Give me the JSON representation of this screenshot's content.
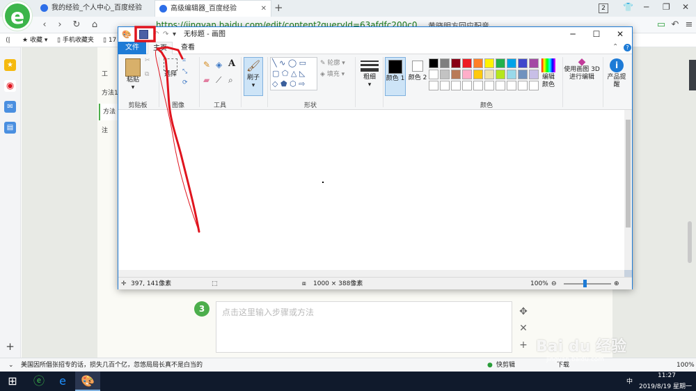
{
  "browser": {
    "tabs": [
      {
        "title": "我的经验_个人中心_百度经验"
      },
      {
        "title": "高级编辑器_百度经验"
      }
    ],
    "new_tab": "+",
    "tab_count": "2",
    "url": "https://jingyan.baidu.com/edit/content?queryId=63afdfc200c0",
    "site_warning": "黄晓明方回应配音",
    "bookmarks": [
      {
        "label": "收藏"
      },
      {
        "label": "手机收藏夹"
      },
      {
        "label": "17"
      }
    ],
    "status_text": "美国因所倡张招专的话，损失几百个亿，忽悠局局长真不是白当的",
    "quick_cut": "快剪辑",
    "download": "下载",
    "zoom": "100%"
  },
  "page": {
    "side_tabs": [
      "工",
      "方法1",
      "方法",
      "注"
    ],
    "step_number": "3",
    "step_placeholder": "点击这里输入步骤或方法",
    "watermark": "Bai du 经验",
    "watermark_url": "jingyan.baidu.com"
  },
  "paint": {
    "title": "无标题 - 画图",
    "tabs": {
      "file": "文件",
      "home": "主页",
      "view": "查看"
    },
    "clipboard": {
      "paste": "粘贴",
      "label": "剪贴板"
    },
    "image": {
      "select": "选择",
      "label": "图像"
    },
    "tools": {
      "label": "工具",
      "text_icon": "A"
    },
    "brush": {
      "label": "刷子"
    },
    "shapes": {
      "outline": "轮廓",
      "fill": "填充",
      "label": "形状"
    },
    "size": {
      "label": "粗细"
    },
    "color1": {
      "label": "颜色 1"
    },
    "color2": {
      "label": "颜色 2"
    },
    "colors_label": "颜色",
    "edit_colors": "编辑颜色",
    "paint3d": "使用画图 3D 进行编辑",
    "product": "产品提醒",
    "status": {
      "cursor_pos": "397, 141像素",
      "canvas_size": "1000 × 388像素",
      "zoom": "100%"
    },
    "palette": [
      "#000000",
      "#7f7f7f",
      "#880015",
      "#ed1c24",
      "#ff7f27",
      "#fff200",
      "#22b14c",
      "#00a2e8",
      "#3f48cc",
      "#a349a4",
      "#ffffff",
      "#c3c3c3",
      "#b97a57",
      "#ffaec9",
      "#ffc90e",
      "#efe4b0",
      "#b5e61d",
      "#99d9ea",
      "#7092be",
      "#c8bfe7"
    ]
  },
  "taskbar": {
    "lang": "中",
    "time": "11:27",
    "date": "2019/8/19 星期一"
  },
  "colors": {
    "accent": "#1e7bd6",
    "annotation": "#e0141e",
    "green": "#3cb54a"
  }
}
